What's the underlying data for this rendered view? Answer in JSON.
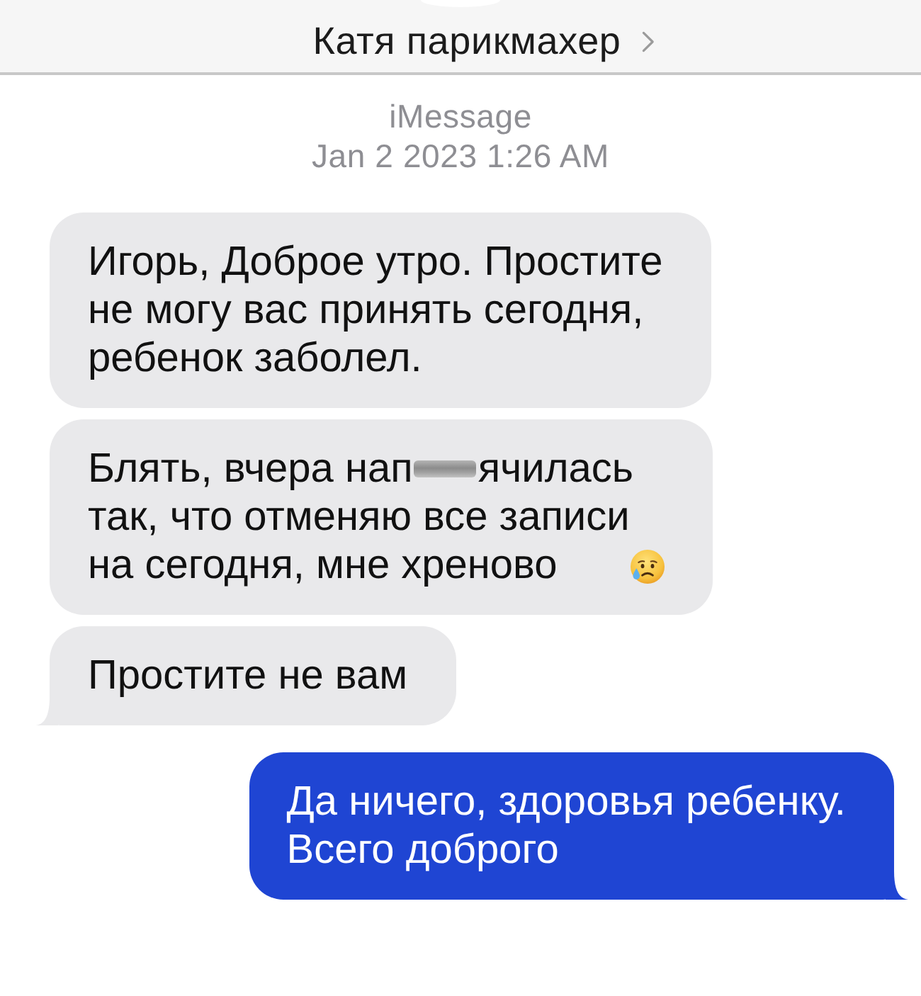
{
  "header": {
    "contact_name": "Катя парикмахер"
  },
  "conversation": {
    "service": "iMessage",
    "timestamp": "Jan 2 2023 1:26 AM"
  },
  "messages": [
    {
      "kind": "incoming",
      "tail": false,
      "parts": [
        {
          "kind": "text",
          "text": "Игорь, Доброе утро. Простите\nне могу вас принять сегодня,\nребенок заболел."
        }
      ]
    },
    {
      "kind": "incoming",
      "tail": false,
      "parts": [
        {
          "kind": "text",
          "text": "Блять, вчера нап"
        },
        {
          "kind": "redaction"
        },
        {
          "kind": "text",
          "text": "ячилась"
        },
        {
          "kind": "break"
        },
        {
          "kind": "text",
          "text": "так, что отменяю все записи\nна сегодня, мне хреново"
        },
        {
          "kind": "emoji"
        }
      ]
    },
    {
      "kind": "incoming",
      "tail": true,
      "parts": [
        {
          "kind": "text",
          "text": "Простите не вам"
        }
      ]
    },
    {
      "kind": "outgoing",
      "tail": true,
      "parts": [
        {
          "kind": "text",
          "text": "Да ничего, здоровья ребенку.\nВсего доброго"
        }
      ]
    }
  ]
}
